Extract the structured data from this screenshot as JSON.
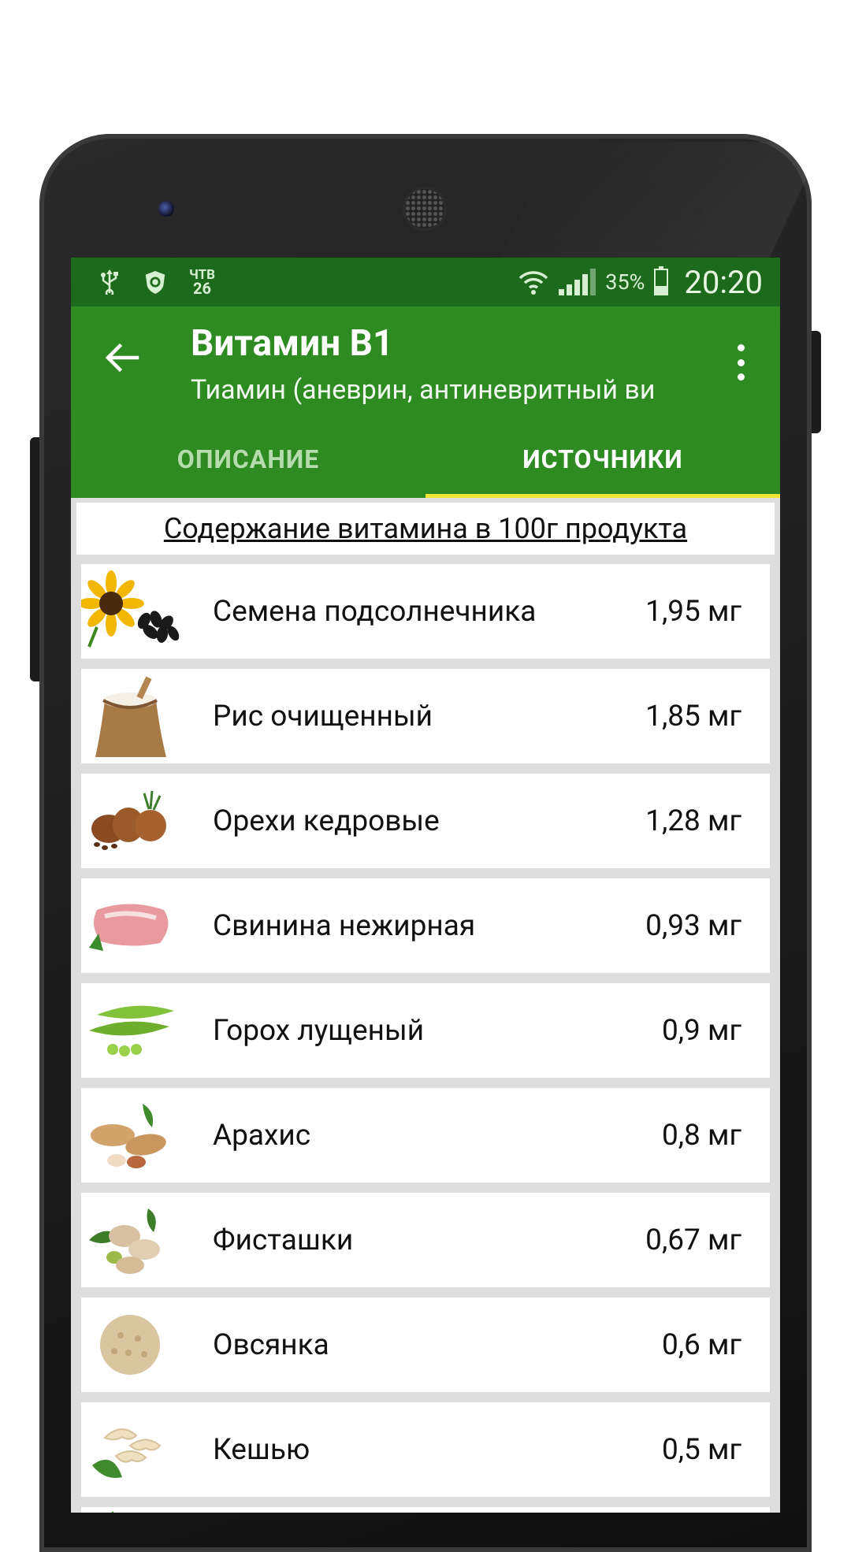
{
  "status_bar": {
    "date_day": "ЧТВ",
    "date_num": "26",
    "battery_percent": "35%",
    "battery_level": 0.35,
    "time": "20:20"
  },
  "app_bar": {
    "title": "Витамин В1",
    "subtitle": "Тиамин (аневрин, антиневритный ви"
  },
  "tabs": [
    {
      "label": "ОПИСАНИЕ",
      "active": false
    },
    {
      "label": "ИСТОЧНИКИ",
      "active": true
    }
  ],
  "section_title": "Содержание витамина в 100г продукта",
  "items": [
    {
      "name": "Семена подсолнечника",
      "value": "1,95 мг",
      "icon": "sunflower-seeds-image"
    },
    {
      "name": "Рис очищенный",
      "value": "1,85 мг",
      "icon": "rice-sack-image"
    },
    {
      "name": "Орехи кедровые",
      "value": "1,28 мг",
      "icon": "pine-nuts-image"
    },
    {
      "name": "Свинина нежирная",
      "value": "0,93 мг",
      "icon": "pork-image"
    },
    {
      "name": "Горох лущеный",
      "value": "0,9 мг",
      "icon": "peas-image"
    },
    {
      "name": "Арахис",
      "value": "0,8 мг",
      "icon": "peanuts-image"
    },
    {
      "name": "Фисташки",
      "value": "0,67 мг",
      "icon": "pistachios-image"
    },
    {
      "name": "Овсянка",
      "value": "0,6 мг",
      "icon": "oatmeal-image"
    },
    {
      "name": "Кешью",
      "value": "0,5 мг",
      "icon": "cashew-image"
    }
  ],
  "colors": {
    "status_bar": "#1e6a1c",
    "app_bar": "#2e8b22",
    "tab_indicator": "#f2e534"
  }
}
